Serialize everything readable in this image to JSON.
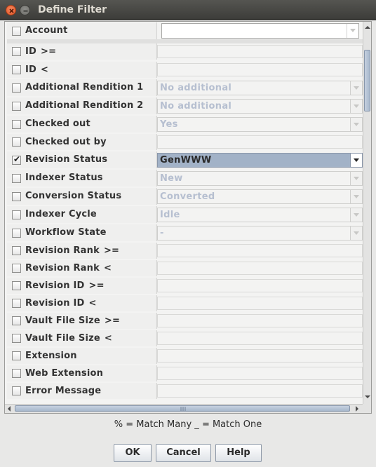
{
  "window": {
    "title": "Define Filter"
  },
  "rows": [
    {
      "label": "Account",
      "op": "",
      "type": "combo-white",
      "value": "",
      "checked": false
    },
    {
      "label": "ID",
      "op": ">=",
      "type": "text",
      "value": "",
      "checked": false
    },
    {
      "label": "ID",
      "op": "<",
      "type": "text",
      "value": "",
      "checked": false
    },
    {
      "label": "Additional Rendition 1",
      "op": "",
      "type": "combo",
      "value": "No additional",
      "checked": false
    },
    {
      "label": "Additional Rendition 2",
      "op": "",
      "type": "combo",
      "value": "No additional",
      "checked": false
    },
    {
      "label": "Checked out",
      "op": "",
      "type": "combo",
      "value": "Yes",
      "checked": false
    },
    {
      "label": "Checked out by",
      "op": "",
      "type": "text",
      "value": "",
      "checked": false
    },
    {
      "label": "Revision Status",
      "op": "",
      "type": "combo-active",
      "value": "GenWWW",
      "checked": true
    },
    {
      "label": "Indexer Status",
      "op": "",
      "type": "combo",
      "value": "New",
      "checked": false
    },
    {
      "label": "Conversion Status",
      "op": "",
      "type": "combo",
      "value": "Converted",
      "checked": false
    },
    {
      "label": "Indexer Cycle",
      "op": "",
      "type": "combo",
      "value": "Idle",
      "checked": false
    },
    {
      "label": "Workflow State",
      "op": "",
      "type": "combo",
      "value": "-",
      "checked": false
    },
    {
      "label": "Revision Rank",
      "op": ">=",
      "type": "text",
      "value": "",
      "checked": false
    },
    {
      "label": "Revision Rank",
      "op": "<",
      "type": "text",
      "value": "",
      "checked": false
    },
    {
      "label": "Revision ID",
      "op": ">=",
      "type": "text",
      "value": "",
      "checked": false
    },
    {
      "label": "Revision ID",
      "op": "<",
      "type": "text",
      "value": "",
      "checked": false
    },
    {
      "label": "Vault File Size",
      "op": ">=",
      "type": "text",
      "value": "",
      "checked": false
    },
    {
      "label": "Vault File Size",
      "op": "<",
      "type": "text",
      "value": "",
      "checked": false
    },
    {
      "label": "Extension",
      "op": "",
      "type": "text",
      "value": "",
      "checked": false
    },
    {
      "label": "Web Extension",
      "op": "",
      "type": "text",
      "value": "",
      "checked": false
    },
    {
      "label": "Error Message",
      "op": "",
      "type": "text",
      "value": "",
      "checked": false
    }
  ],
  "hint": "% = Match Many  _ = Match One",
  "buttons": {
    "ok": "OK",
    "cancel": "Cancel",
    "help": "Help"
  }
}
